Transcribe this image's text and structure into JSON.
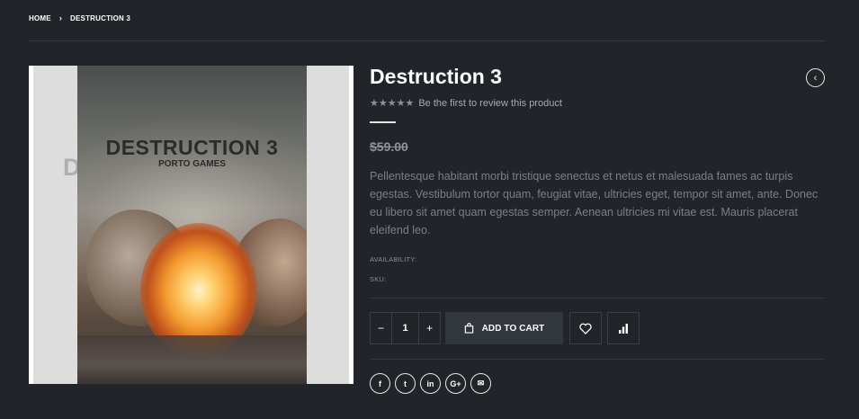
{
  "breadcrumb": {
    "home": "HOME",
    "current": "DESTRUCTION 3"
  },
  "product": {
    "title": "Destruction 3",
    "rating_stars": 5,
    "review_link": "Be the first to review this product",
    "price": "$59.00",
    "description": "Pellentesque habitant morbi tristique senectus et netus et malesuada fames ac turpis egestas. Vestibulum tortor quam, feugiat vitae, ultricies eget, tempor sit amet, ante. Donec eu libero sit amet quam egestas semper. Aenean ultricies mi vitae est. Mauris placerat eleifend leo.",
    "availability_label": "AVAILABILITY:",
    "sku_label": "SKU:"
  },
  "cover": {
    "title": "DESTRUCTION 3",
    "subtitle": "PORTO GAMES"
  },
  "cart": {
    "minus": "−",
    "quantity": "1",
    "plus": "+",
    "add_to_cart": "ADD TO CART"
  },
  "share": {
    "facebook": "f",
    "twitter": "t",
    "linkedin": "in",
    "googleplus": "G+",
    "email": "✉"
  },
  "icons": [
    "chevron-right-icon",
    "chevron-left-icon",
    "star-icon",
    "bag-icon",
    "heart-icon",
    "bar-chart-icon",
    "facebook-icon",
    "twitter-icon",
    "linkedin-icon",
    "googleplus-icon",
    "email-icon"
  ],
  "colors": {
    "background": "#212529",
    "text": "#ffffff",
    "muted": "#7a7f86",
    "button_bg": "#32373d",
    "divider": "#353a40"
  }
}
